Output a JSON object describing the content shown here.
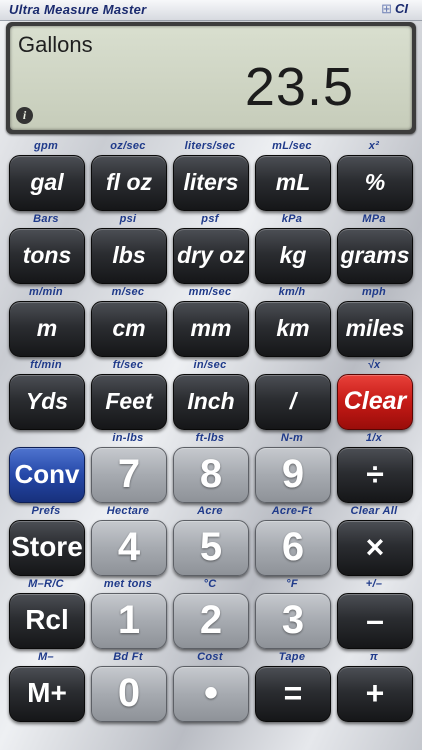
{
  "header": {
    "brand": "Ultra Measure Master",
    "logo_mark": "⊞",
    "logo_text": "CI"
  },
  "display": {
    "unit": "Gallons",
    "value": "23.5",
    "info_icon": "i"
  },
  "rows": [
    [
      {
        "name": "gal-button",
        "label": "gal",
        "sub": "gpm",
        "style": "dark"
      },
      {
        "name": "fl-oz-button",
        "label": "fl oz",
        "sub": "oz/sec",
        "style": "dark"
      },
      {
        "name": "liters-button",
        "label": "liters",
        "sub": "liters/sec",
        "style": "dark"
      },
      {
        "name": "ml-button",
        "label": "mL",
        "sub": "mL/sec",
        "style": "dark"
      },
      {
        "name": "percent-button",
        "label": "%",
        "sub": "x²",
        "style": "dark"
      }
    ],
    [
      {
        "name": "tons-button",
        "label": "tons",
        "sub": "Bars",
        "style": "dark"
      },
      {
        "name": "lbs-button",
        "label": "lbs",
        "sub": "psi",
        "style": "dark"
      },
      {
        "name": "dry-oz-button",
        "label": "dry oz",
        "sub": "psf",
        "style": "dark"
      },
      {
        "name": "kg-button",
        "label": "kg",
        "sub": "kPa",
        "style": "dark"
      },
      {
        "name": "grams-button",
        "label": "grams",
        "sub": "MPa",
        "style": "dark"
      }
    ],
    [
      {
        "name": "m-button",
        "label": "m",
        "sub": "m/min",
        "style": "dark"
      },
      {
        "name": "cm-button",
        "label": "cm",
        "sub": "m/sec",
        "style": "dark"
      },
      {
        "name": "mm-button",
        "label": "mm",
        "sub": "mm/sec",
        "style": "dark"
      },
      {
        "name": "km-button",
        "label": "km",
        "sub": "km/h",
        "style": "dark"
      },
      {
        "name": "miles-button",
        "label": "miles",
        "sub": "mph",
        "style": "dark"
      }
    ],
    [
      {
        "name": "yds-button",
        "label": "Yds",
        "sub": "ft/min",
        "style": "dark"
      },
      {
        "name": "feet-button",
        "label": "Feet",
        "sub": "ft/sec",
        "style": "dark"
      },
      {
        "name": "inch-button",
        "label": "Inch",
        "sub": "in/sec",
        "style": "dark"
      },
      {
        "name": "fraction-button",
        "label": "/",
        "sub": "",
        "style": "dark"
      },
      {
        "name": "clear-button",
        "label": "Clear",
        "sub": "√x",
        "style": "red"
      }
    ],
    [
      {
        "name": "conv-button",
        "label": "Conv",
        "sub": "",
        "style": "blue"
      },
      {
        "name": "seven-button",
        "label": "7",
        "sub": "in-lbs",
        "style": "num"
      },
      {
        "name": "eight-button",
        "label": "8",
        "sub": "ft-lbs",
        "style": "num"
      },
      {
        "name": "nine-button",
        "label": "9",
        "sub": "N-m",
        "style": "num"
      },
      {
        "name": "divide-button",
        "label": "÷",
        "sub": "1/x",
        "style": "dark-op"
      }
    ],
    [
      {
        "name": "store-button",
        "label": "Store",
        "sub": "Prefs",
        "style": "dark-plain"
      },
      {
        "name": "four-button",
        "label": "4",
        "sub": "Hectare",
        "style": "num"
      },
      {
        "name": "five-button",
        "label": "5",
        "sub": "Acre",
        "style": "num"
      },
      {
        "name": "six-button",
        "label": "6",
        "sub": "Acre-Ft",
        "style": "num"
      },
      {
        "name": "multiply-button",
        "label": "×",
        "sub": "Clear All",
        "style": "dark-op"
      }
    ],
    [
      {
        "name": "rcl-button",
        "label": "Rcl",
        "sub": "M–R/C",
        "style": "dark-plain"
      },
      {
        "name": "one-button",
        "label": "1",
        "sub": "met tons",
        "style": "num"
      },
      {
        "name": "two-button",
        "label": "2",
        "sub": "°C",
        "style": "num"
      },
      {
        "name": "three-button",
        "label": "3",
        "sub": "°F",
        "style": "num"
      },
      {
        "name": "minus-button",
        "label": "–",
        "sub": "+/–",
        "style": "dark-op"
      }
    ],
    [
      {
        "name": "m-plus-button",
        "label": "M+",
        "sub": "M–",
        "style": "dark-plain"
      },
      {
        "name": "zero-button",
        "label": "0",
        "sub": "Bd Ft",
        "style": "num"
      },
      {
        "name": "decimal-button",
        "label": "•",
        "sub": "Cost",
        "style": "num"
      },
      {
        "name": "equals-button",
        "label": "=",
        "sub": "Tape",
        "style": "dark-op"
      },
      {
        "name": "plus-button",
        "label": "+",
        "sub": "π",
        "style": "dark-op"
      }
    ]
  ]
}
